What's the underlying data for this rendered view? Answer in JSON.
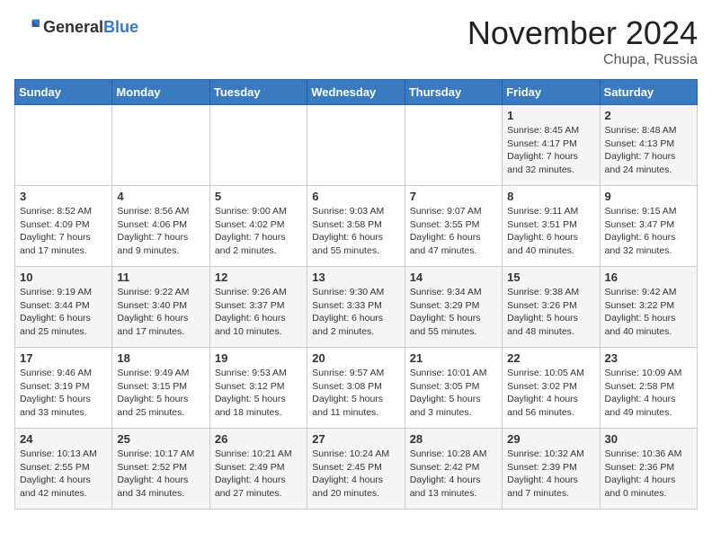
{
  "header": {
    "logo_general": "General",
    "logo_blue": "Blue",
    "month_title": "November 2024",
    "location": "Chupa, Russia"
  },
  "days_of_week": [
    "Sunday",
    "Monday",
    "Tuesday",
    "Wednesday",
    "Thursday",
    "Friday",
    "Saturday"
  ],
  "weeks": [
    [
      {
        "day": "",
        "info": ""
      },
      {
        "day": "",
        "info": ""
      },
      {
        "day": "",
        "info": ""
      },
      {
        "day": "",
        "info": ""
      },
      {
        "day": "",
        "info": ""
      },
      {
        "day": "1",
        "info": "Sunrise: 8:45 AM\nSunset: 4:17 PM\nDaylight: 7 hours\nand 32 minutes."
      },
      {
        "day": "2",
        "info": "Sunrise: 8:48 AM\nSunset: 4:13 PM\nDaylight: 7 hours\nand 24 minutes."
      }
    ],
    [
      {
        "day": "3",
        "info": "Sunrise: 8:52 AM\nSunset: 4:09 PM\nDaylight: 7 hours\nand 17 minutes."
      },
      {
        "day": "4",
        "info": "Sunrise: 8:56 AM\nSunset: 4:06 PM\nDaylight: 7 hours\nand 9 minutes."
      },
      {
        "day": "5",
        "info": "Sunrise: 9:00 AM\nSunset: 4:02 PM\nDaylight: 7 hours\nand 2 minutes."
      },
      {
        "day": "6",
        "info": "Sunrise: 9:03 AM\nSunset: 3:58 PM\nDaylight: 6 hours\nand 55 minutes."
      },
      {
        "day": "7",
        "info": "Sunrise: 9:07 AM\nSunset: 3:55 PM\nDaylight: 6 hours\nand 47 minutes."
      },
      {
        "day": "8",
        "info": "Sunrise: 9:11 AM\nSunset: 3:51 PM\nDaylight: 6 hours\nand 40 minutes."
      },
      {
        "day": "9",
        "info": "Sunrise: 9:15 AM\nSunset: 3:47 PM\nDaylight: 6 hours\nand 32 minutes."
      }
    ],
    [
      {
        "day": "10",
        "info": "Sunrise: 9:19 AM\nSunset: 3:44 PM\nDaylight: 6 hours\nand 25 minutes."
      },
      {
        "day": "11",
        "info": "Sunrise: 9:22 AM\nSunset: 3:40 PM\nDaylight: 6 hours\nand 17 minutes."
      },
      {
        "day": "12",
        "info": "Sunrise: 9:26 AM\nSunset: 3:37 PM\nDaylight: 6 hours\nand 10 minutes."
      },
      {
        "day": "13",
        "info": "Sunrise: 9:30 AM\nSunset: 3:33 PM\nDaylight: 6 hours\nand 2 minutes."
      },
      {
        "day": "14",
        "info": "Sunrise: 9:34 AM\nSunset: 3:29 PM\nDaylight: 5 hours\nand 55 minutes."
      },
      {
        "day": "15",
        "info": "Sunrise: 9:38 AM\nSunset: 3:26 PM\nDaylight: 5 hours\nand 48 minutes."
      },
      {
        "day": "16",
        "info": "Sunrise: 9:42 AM\nSunset: 3:22 PM\nDaylight: 5 hours\nand 40 minutes."
      }
    ],
    [
      {
        "day": "17",
        "info": "Sunrise: 9:46 AM\nSunset: 3:19 PM\nDaylight: 5 hours\nand 33 minutes."
      },
      {
        "day": "18",
        "info": "Sunrise: 9:49 AM\nSunset: 3:15 PM\nDaylight: 5 hours\nand 25 minutes."
      },
      {
        "day": "19",
        "info": "Sunrise: 9:53 AM\nSunset: 3:12 PM\nDaylight: 5 hours\nand 18 minutes."
      },
      {
        "day": "20",
        "info": "Sunrise: 9:57 AM\nSunset: 3:08 PM\nDaylight: 5 hours\nand 11 minutes."
      },
      {
        "day": "21",
        "info": "Sunrise: 10:01 AM\nSunset: 3:05 PM\nDaylight: 5 hours\nand 3 minutes."
      },
      {
        "day": "22",
        "info": "Sunrise: 10:05 AM\nSunset: 3:02 PM\nDaylight: 4 hours\nand 56 minutes."
      },
      {
        "day": "23",
        "info": "Sunrise: 10:09 AM\nSunset: 2:58 PM\nDaylight: 4 hours\nand 49 minutes."
      }
    ],
    [
      {
        "day": "24",
        "info": "Sunrise: 10:13 AM\nSunset: 2:55 PM\nDaylight: 4 hours\nand 42 minutes."
      },
      {
        "day": "25",
        "info": "Sunrise: 10:17 AM\nSunset: 2:52 PM\nDaylight: 4 hours\nand 34 minutes."
      },
      {
        "day": "26",
        "info": "Sunrise: 10:21 AM\nSunset: 2:49 PM\nDaylight: 4 hours\nand 27 minutes."
      },
      {
        "day": "27",
        "info": "Sunrise: 10:24 AM\nSunset: 2:45 PM\nDaylight: 4 hours\nand 20 minutes."
      },
      {
        "day": "28",
        "info": "Sunrise: 10:28 AM\nSunset: 2:42 PM\nDaylight: 4 hours\nand 13 minutes."
      },
      {
        "day": "29",
        "info": "Sunrise: 10:32 AM\nSunset: 2:39 PM\nDaylight: 4 hours\nand 7 minutes."
      },
      {
        "day": "30",
        "info": "Sunrise: 10:36 AM\nSunset: 2:36 PM\nDaylight: 4 hours\nand 0 minutes."
      }
    ]
  ]
}
